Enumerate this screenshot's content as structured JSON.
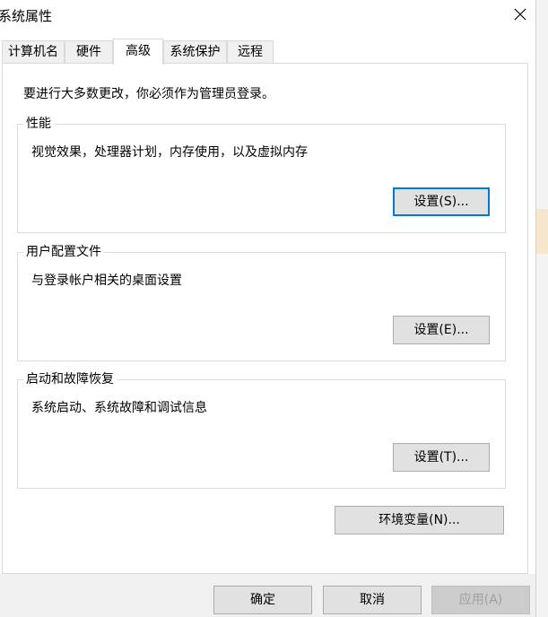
{
  "window": {
    "title": "系统属性"
  },
  "tabs": [
    {
      "label": "计算机名",
      "active": false
    },
    {
      "label": "硬件",
      "active": false
    },
    {
      "label": "高级",
      "active": true
    },
    {
      "label": "系统保护",
      "active": false
    },
    {
      "label": "远程",
      "active": false
    }
  ],
  "notice": "要进行大多数更改，你必须作为管理员登录。",
  "groups": {
    "performance": {
      "title": "性能",
      "desc": "视觉效果，处理器计划，内存使用，以及虚拟内存",
      "button": "设置(S)..."
    },
    "user_profiles": {
      "title": "用户配置文件",
      "desc": "与登录帐户相关的桌面设置",
      "button": "设置(E)..."
    },
    "startup_recovery": {
      "title": "启动和故障恢复",
      "desc": "系统启动、系统故障和调试信息",
      "button": "设置(T)..."
    }
  },
  "env_button": "环境变量(N)...",
  "footer": {
    "ok": "确定",
    "cancel": "取消",
    "apply": "应用(A)"
  },
  "colors": {
    "focus_border": "#0078d7",
    "background_accent": "#f5e6cc"
  }
}
